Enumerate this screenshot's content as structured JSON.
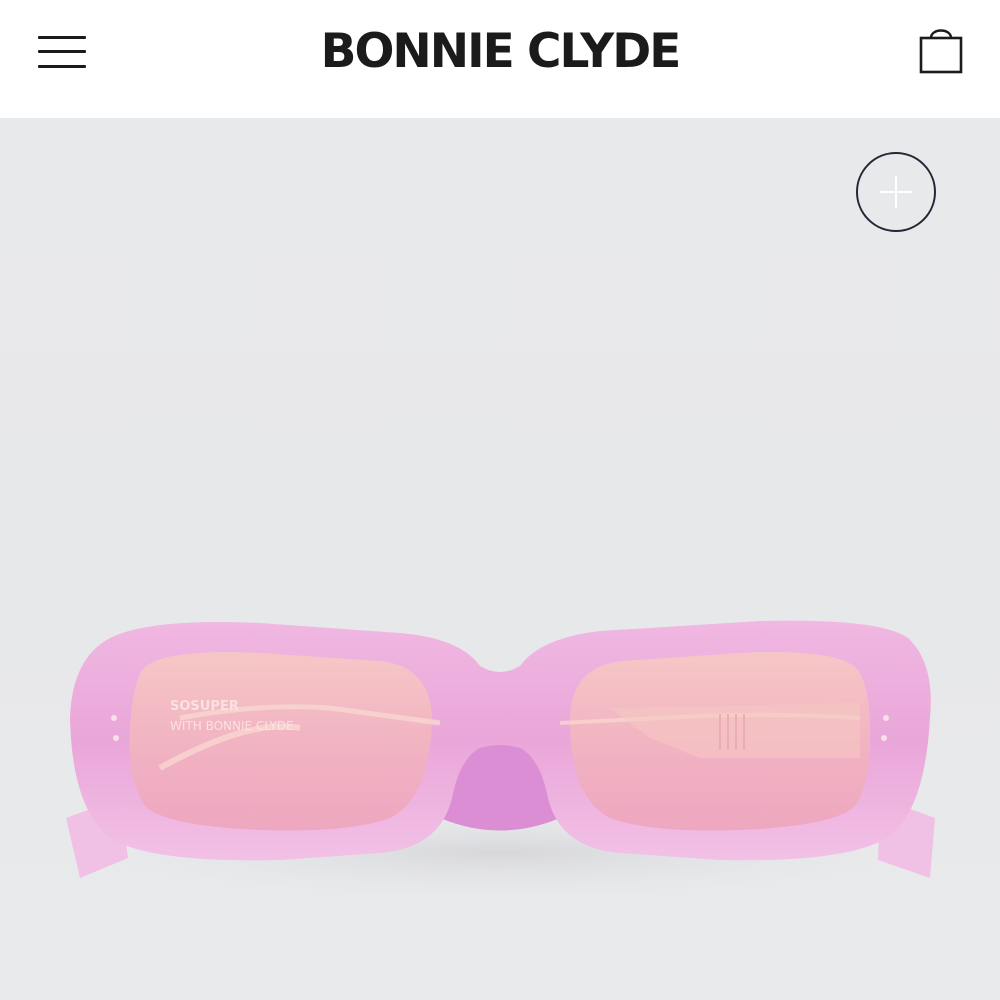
{
  "header": {
    "brand": "BONNIE CLYDE",
    "menu_icon": "hamburger-menu-icon",
    "cart_icon": "shopping-bag-icon"
  },
  "product": {
    "image_alt": "Pink rectangular sunglasses",
    "frame_text_left_line1": "SOSUPER",
    "frame_text_left_line2": "WITH BONNIE CLYDE",
    "zoom_icon": "plus-icon"
  },
  "colors": {
    "background": "#e8e9eb",
    "frame": "#e9a7da",
    "lens": "#f0b2c3",
    "text": "#1b1b1b"
  }
}
